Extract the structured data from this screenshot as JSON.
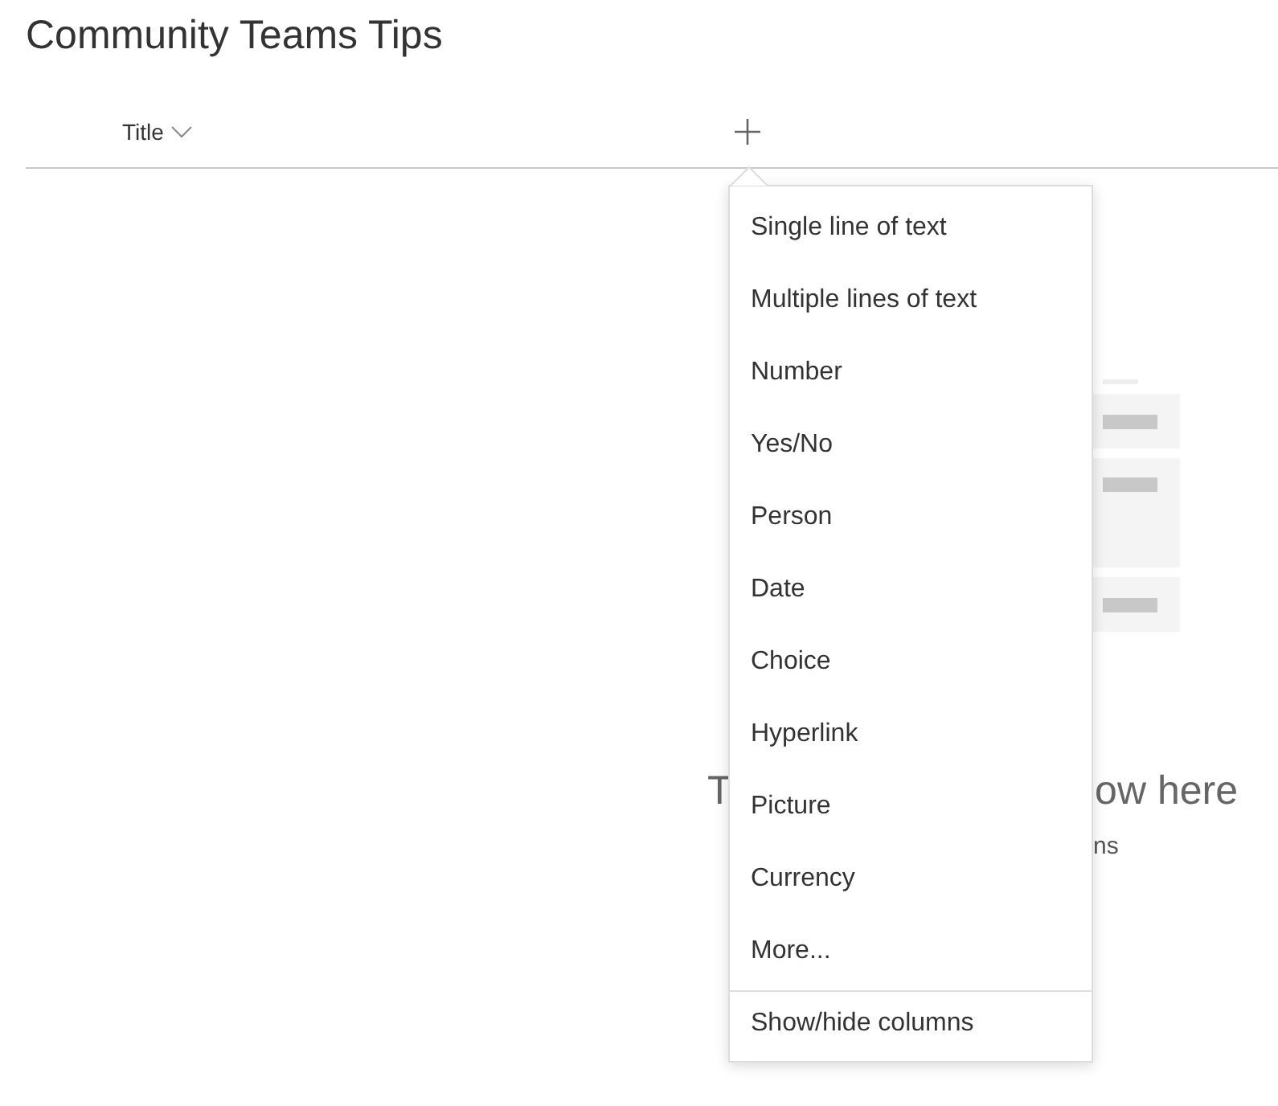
{
  "page_title": "Community Teams Tips",
  "columns": [
    {
      "label": "Title"
    }
  ],
  "empty_state": {
    "heading_left": "T",
    "heading_right": "ow here",
    "subtext": "ns"
  },
  "menu": {
    "items": [
      {
        "label": "Single line of text"
      },
      {
        "label": "Multiple lines of text"
      },
      {
        "label": "Number"
      },
      {
        "label": "Yes/No"
      },
      {
        "label": "Person"
      },
      {
        "label": "Date"
      },
      {
        "label": "Choice"
      },
      {
        "label": "Hyperlink"
      },
      {
        "label": "Picture"
      },
      {
        "label": "Currency"
      },
      {
        "label": "More..."
      }
    ],
    "footer_item": "Show/hide columns"
  }
}
